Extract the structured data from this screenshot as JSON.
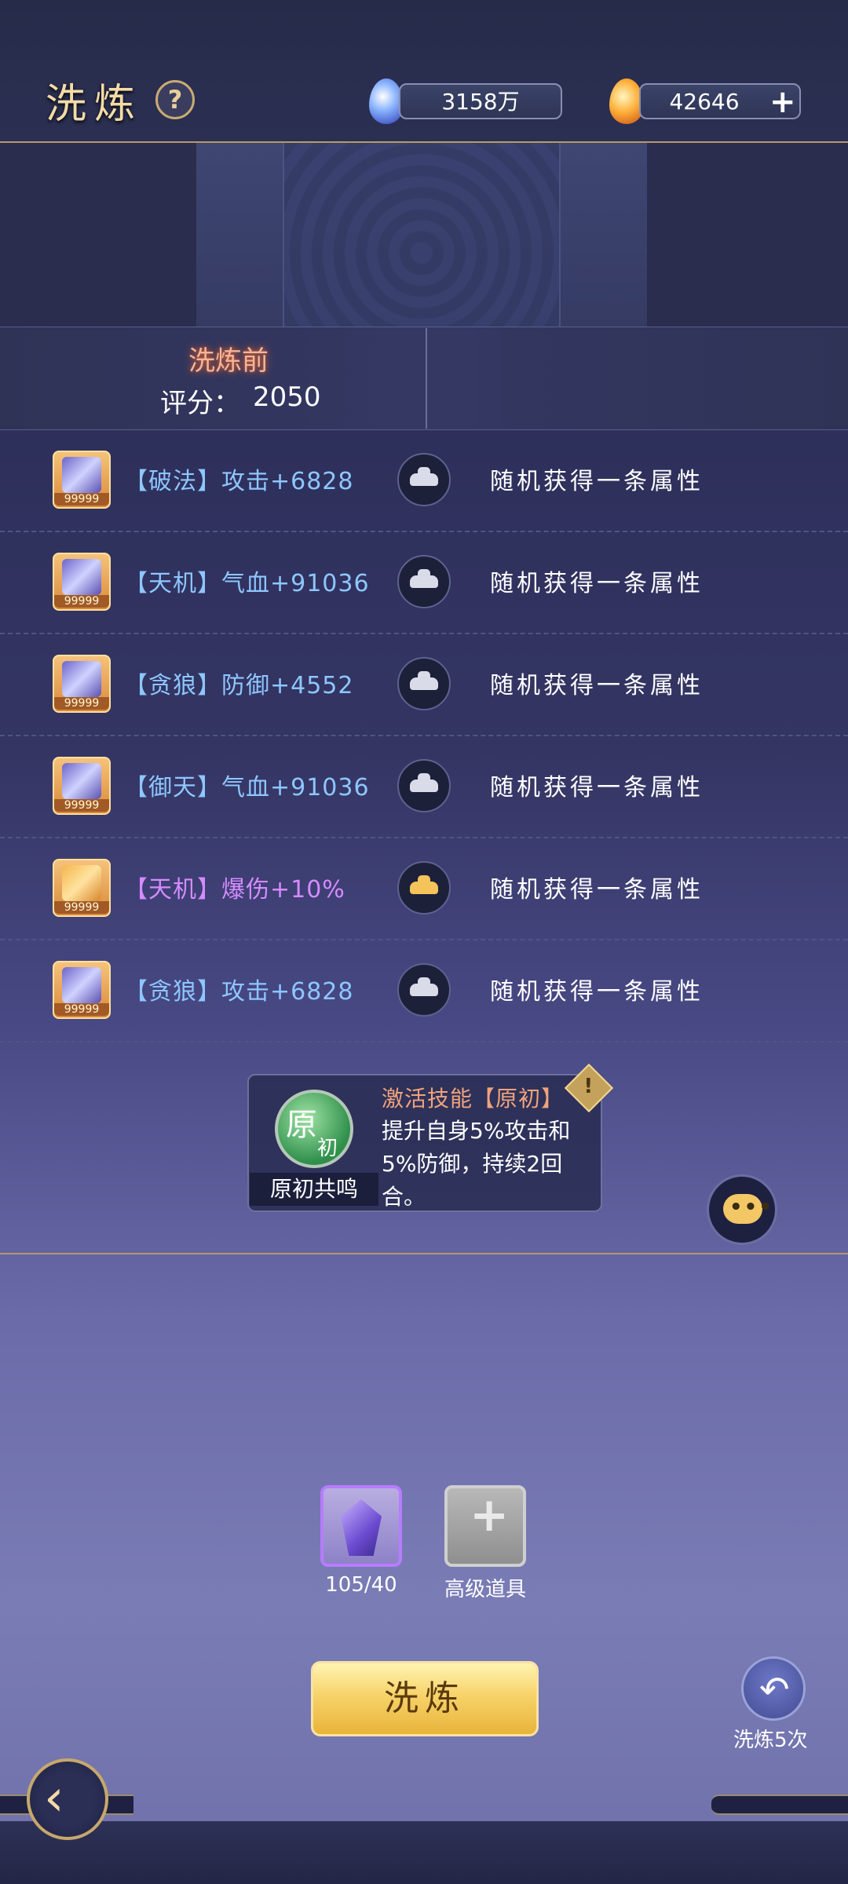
{
  "header": {
    "title": "洗炼",
    "help_icon": "?",
    "currency1": "3158万",
    "currency2": "42646",
    "currency2_add": "+"
  },
  "section": {
    "title": "洗炼前",
    "score_label": "评分：",
    "score_value": "2050"
  },
  "rows": [
    {
      "attr": "【破法】攻击+6828",
      "result": "随机获得一条属性",
      "badge": "99999",
      "color": "blue",
      "lock": "silver"
    },
    {
      "attr": "【天机】气血+91036",
      "result": "随机获得一条属性",
      "badge": "99999",
      "color": "blue",
      "lock": "silver"
    },
    {
      "attr": "【贪狼】防御+4552",
      "result": "随机获得一条属性",
      "badge": "99999",
      "color": "blue",
      "lock": "silver"
    },
    {
      "attr": "【御天】气血+91036",
      "result": "随机获得一条属性",
      "badge": "99999",
      "color": "blue",
      "lock": "silver"
    },
    {
      "attr": "【天机】爆伤+10%",
      "result": "随机获得一条属性",
      "badge": "99999",
      "color": "purple",
      "lock": "gold"
    },
    {
      "attr": "【贪狼】攻击+6828",
      "result": "随机获得一条属性",
      "badge": "99999",
      "color": "blue",
      "lock": "silver"
    }
  ],
  "skill": {
    "badge_char1": "原",
    "badge_char2": "初",
    "name": "原初共鸣",
    "title": "激活技能【原初】",
    "desc": "提升自身5%攻击和5%防御，持续2回合。",
    "warn": "!"
  },
  "items": {
    "crystal_count": "105/40",
    "advanced_label": "高级道具"
  },
  "actions": {
    "wash_label": "洗炼",
    "undo_label": "洗炼5次"
  },
  "colors": {
    "accent_gold": "#f3dba8",
    "attr_blue": "#8ec6ff",
    "attr_purple": "#d48bff"
  }
}
